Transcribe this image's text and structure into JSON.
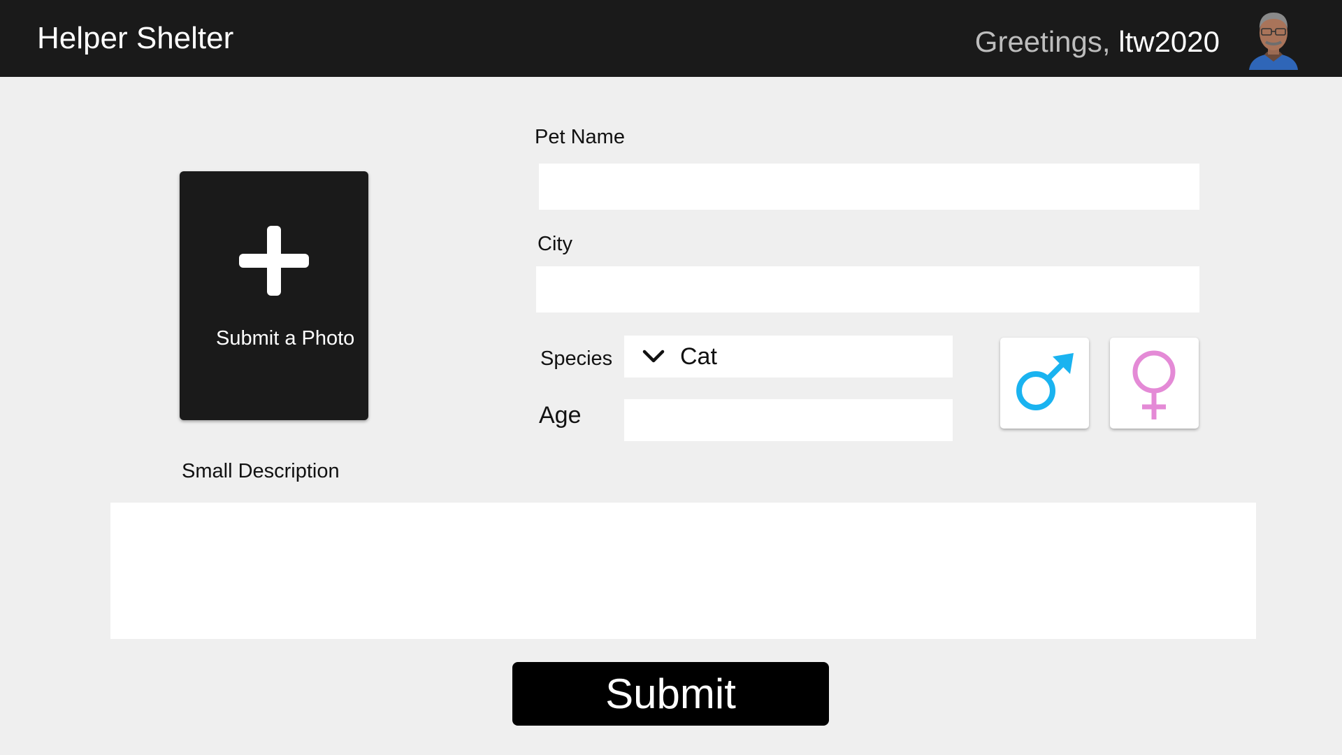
{
  "header": {
    "app_title": "Helper Shelter",
    "greeting_prefix": "Greetings, ",
    "username": "ltw2020",
    "avatar_icon": "user-avatar"
  },
  "photo_upload": {
    "icon": "plus-icon",
    "label": "Submit a Photo"
  },
  "form": {
    "pet_name": {
      "label": "Pet Name",
      "value": ""
    },
    "city": {
      "label": "City",
      "value": ""
    },
    "species": {
      "label": "Species",
      "selected": "Cat",
      "icon": "chevron-down-icon"
    },
    "age": {
      "label": "Age",
      "value": ""
    },
    "gender": {
      "male": {
        "icon": "male-symbol-icon",
        "color": "#1ab3f0"
      },
      "female": {
        "icon": "female-symbol-icon",
        "color": "#e48ad6"
      }
    },
    "description": {
      "label": "Small Description",
      "value": ""
    }
  },
  "actions": {
    "submit_label": "Submit"
  },
  "colors": {
    "header_bg": "#1a1a1a",
    "page_bg": "#efefef",
    "button_bg": "#000000"
  }
}
